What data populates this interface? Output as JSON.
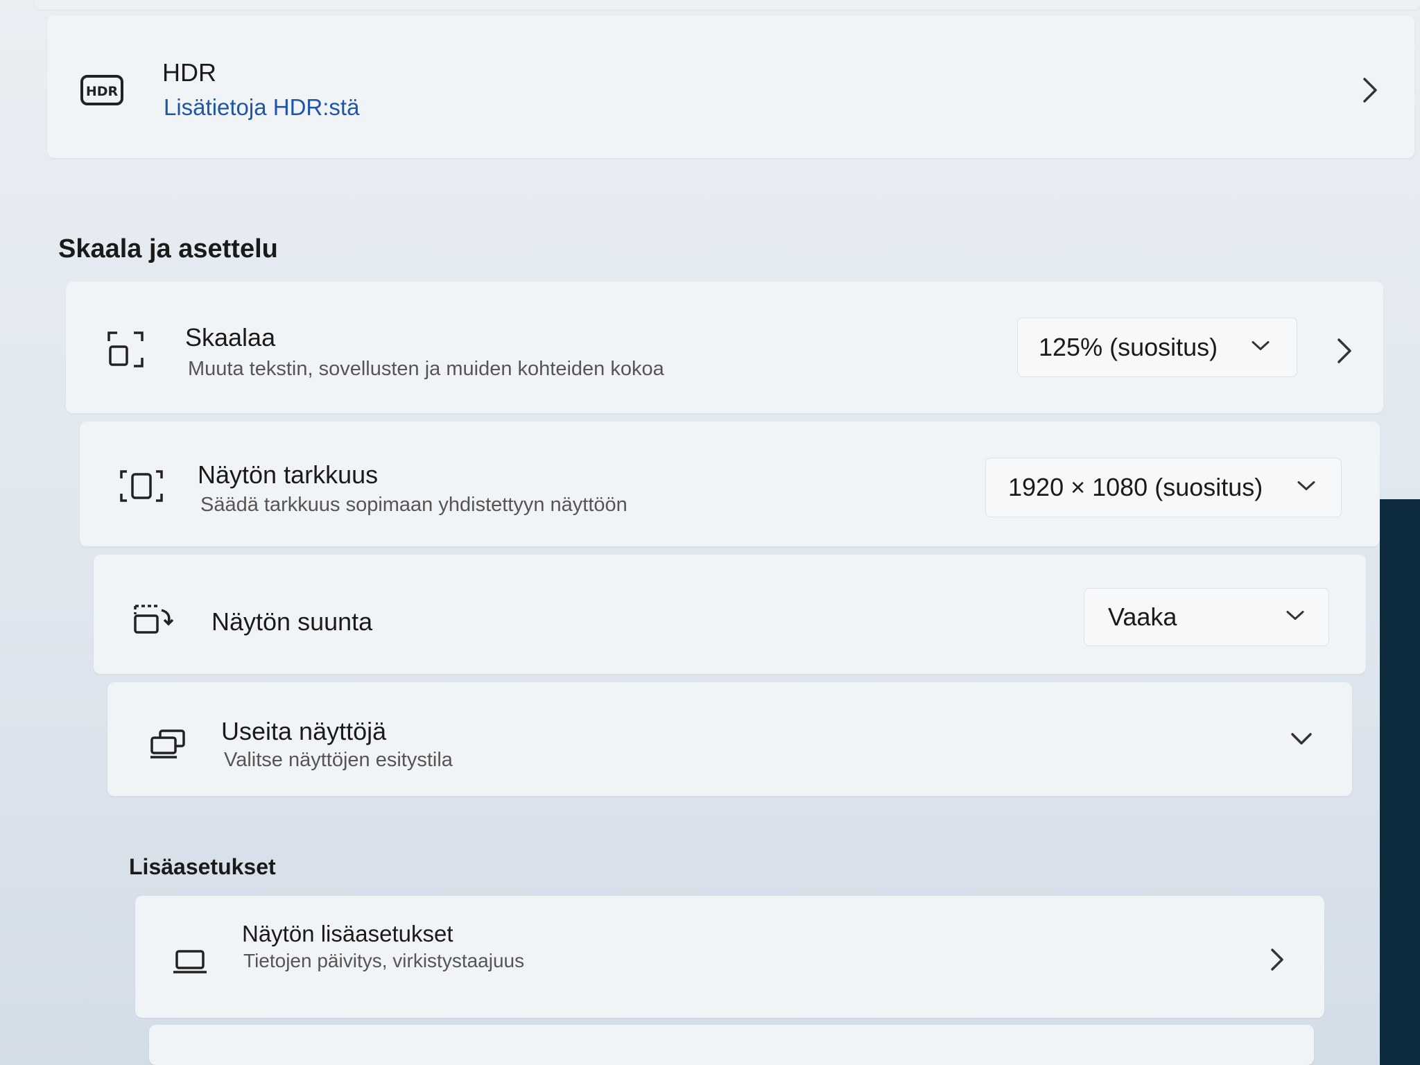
{
  "hdr": {
    "icon": "hdr-icon",
    "icon_text": "HDR",
    "title": "HDR",
    "link": "Lisätietoja HDR:stä"
  },
  "section_scale": {
    "heading": "Skaala ja asettelu"
  },
  "scale": {
    "icon": "scale-icon",
    "title": "Skaalaa",
    "subtitle": "Muuta tekstin, sovellusten ja muiden kohteiden kokoa",
    "value": "125% (suositus)"
  },
  "resolution": {
    "icon": "resolution-icon",
    "title": "Näytön tarkkuus",
    "subtitle": "Säädä tarkkuus sopimaan yhdistettyyn näyttöön",
    "value": "1920 × 1080 (suositus)"
  },
  "orientation": {
    "icon": "rotate-display-icon",
    "title": "Näytön suunta",
    "value": "Vaaka"
  },
  "multiple_displays": {
    "icon": "multiple-displays-icon",
    "title": "Useita näyttöjä",
    "subtitle": "Valitse näyttöjen esitystila"
  },
  "section_advanced": {
    "heading": "Lisäasetukset"
  },
  "advanced_display": {
    "icon": "laptop-icon",
    "title": "Näytön lisäasetukset",
    "subtitle": "Tietojen päivitys, virkistystaajuus"
  },
  "colors": {
    "accent_link": "#1f55a8",
    "card": "#f1f4f7",
    "background": "#e3e9ef"
  }
}
